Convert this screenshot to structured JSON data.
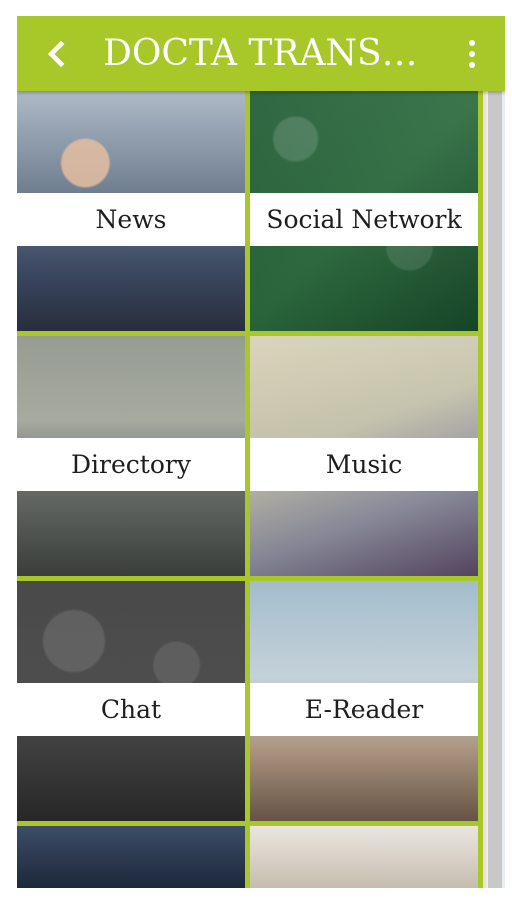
{
  "appbar": {
    "title": "DOCTA TRANS…",
    "back_icon": "chevron-left-icon",
    "menu_icon": "kebab-menu-icon"
  },
  "colors": {
    "accent": "#a7c828",
    "label_bg": "#ffffff",
    "label_text": "#1e1e1e",
    "scrollbar": "#c8c8c8"
  },
  "tiles": [
    {
      "label": "News"
    },
    {
      "label": "Social Network"
    },
    {
      "label": "Directory"
    },
    {
      "label": "Music"
    },
    {
      "label": "Chat"
    },
    {
      "label": "E-Reader"
    },
    {
      "label": ""
    },
    {
      "label": ""
    }
  ]
}
